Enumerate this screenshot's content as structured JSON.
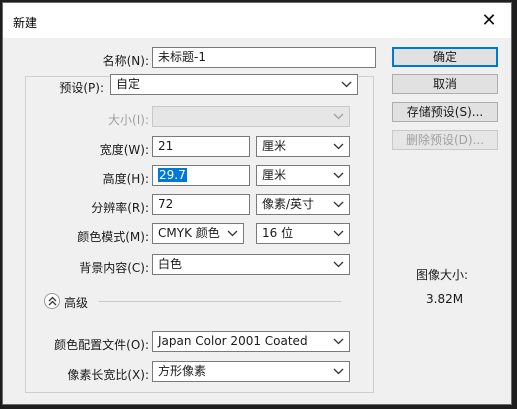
{
  "window": {
    "title": "新建",
    "close_glyph": "✕"
  },
  "form": {
    "name_label": "名称(N):",
    "name_value": "未标题-1",
    "preset_label": "预设(P):",
    "preset_value": "自定",
    "size_label": "大小(I):",
    "size_value": "",
    "width_label": "宽度(W):",
    "width_value": "21",
    "width_unit": "厘米",
    "height_label": "高度(H):",
    "height_value": "29.7",
    "height_unit": "厘米",
    "resolution_label": "分辨率(R):",
    "resolution_value": "72",
    "resolution_unit": "像素/英寸",
    "color_mode_label": "颜色模式(M):",
    "color_mode_value": "CMYK 颜色",
    "bit_depth_value": "16 位",
    "background_label": "背景内容(C):",
    "background_value": "白色",
    "advanced_label": "高级",
    "color_profile_label": "颜色配置文件(O):",
    "color_profile_value": "Japan Color 2001 Coated",
    "pixel_aspect_label": "像素长宽比(X):",
    "pixel_aspect_value": "方形像素"
  },
  "buttons": {
    "ok": "确定",
    "cancel": "取消",
    "save_preset": "存储预设(S)...",
    "delete_preset": "删除预设(D)..."
  },
  "image_size": {
    "label": "图像大小:",
    "value": "3.82M"
  },
  "colors": {
    "accent": "#0078d7",
    "dialog_bg": "#f0f0f0",
    "titlebar_bg": "#ffffff",
    "outer_bg": "#1e1e1e"
  },
  "icons": {
    "chevron": "chevron-down-icon",
    "collapse": "double-chevron-up-icon",
    "close": "close-icon"
  }
}
